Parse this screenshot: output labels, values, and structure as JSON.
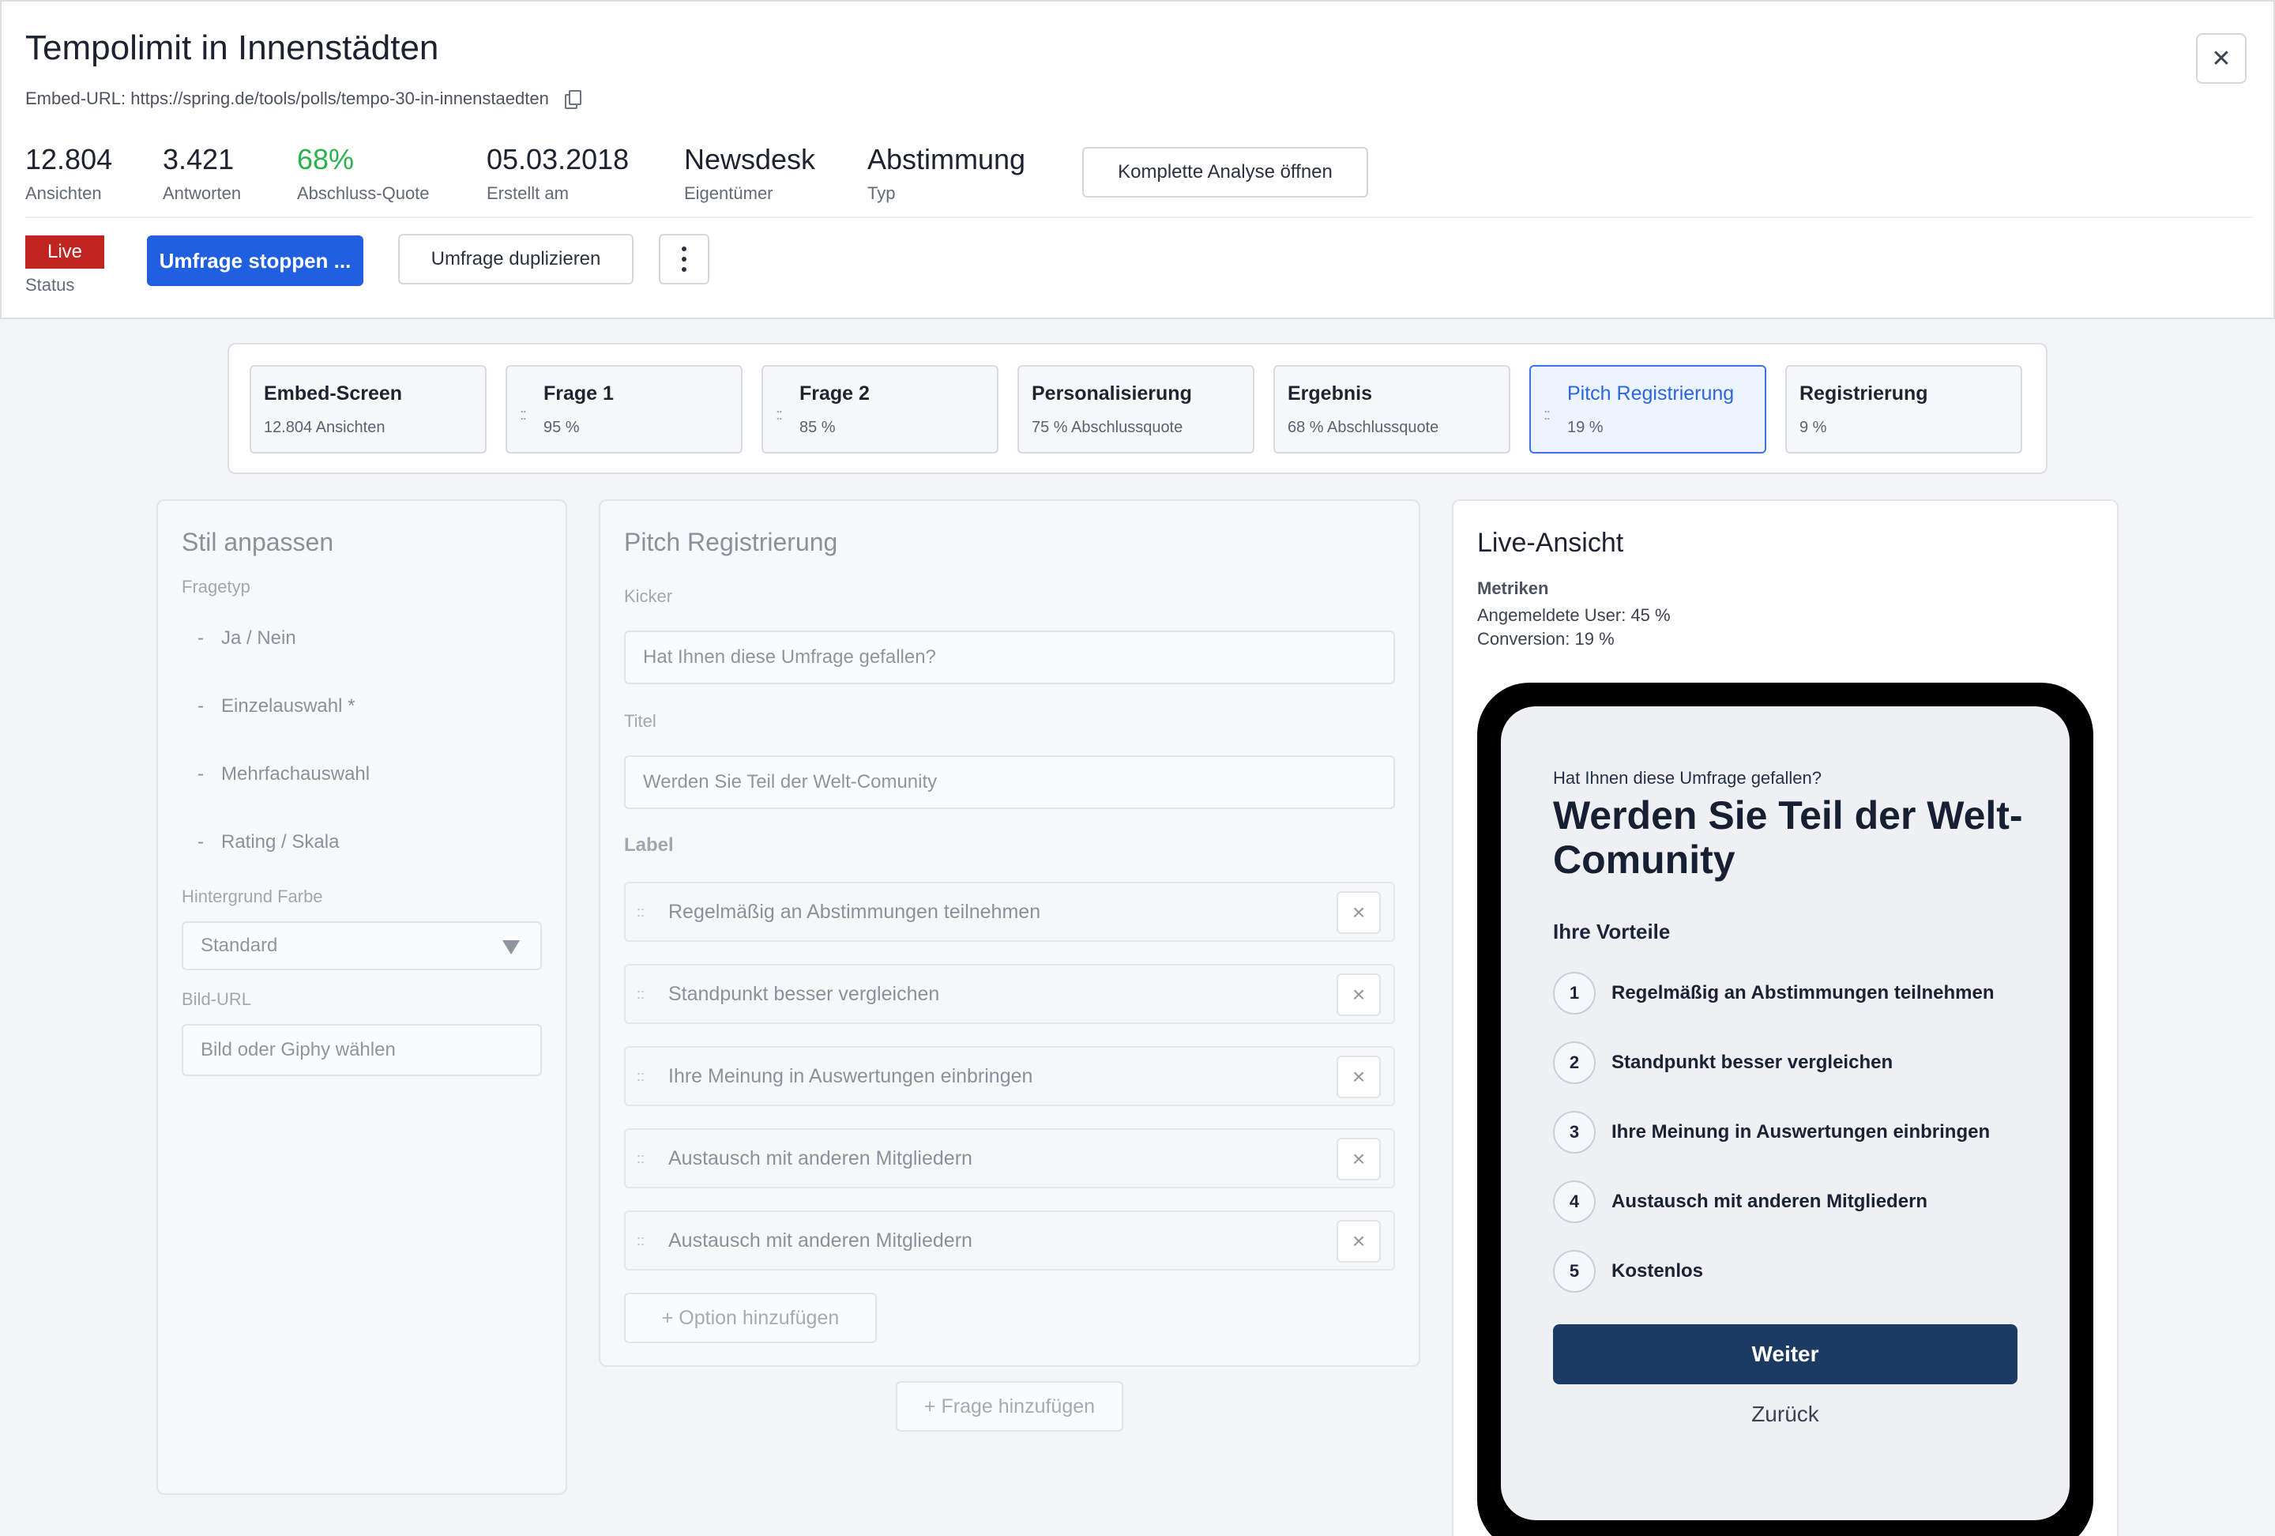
{
  "header": {
    "title": "Tempolimit in Innenstädten",
    "embed_url_label": "Embed-URL: https://spring.de/tools/polls/tempo-30-in-innenstaedten",
    "stats": [
      {
        "value": "12.804",
        "label": "Ansichten"
      },
      {
        "value": "3.421",
        "label": "Antworten"
      },
      {
        "value": "68%",
        "label": "Abschluss-Quote"
      },
      {
        "value": "05.03.2018",
        "label": "Erstellt am"
      },
      {
        "value": "Newsdesk",
        "label": "Eigentümer"
      },
      {
        "value": "Abstimmung",
        "label": "Typ"
      }
    ],
    "analysis_button": "Komplette Analyse öffnen",
    "status_badge": "Live",
    "status_label": "Status",
    "stop_button": "Umfrage stoppen ...",
    "duplicate_button": "Umfrage duplizieren",
    "close_symbol": "✕",
    "accent_color": "#1f5fe0",
    "live_color": "#c0251f",
    "quote_color": "#2bb24c"
  },
  "steps": [
    {
      "title": "Embed-Screen",
      "sub": "12.804 Ansichten"
    },
    {
      "title": "Frage 1",
      "sub": "95 %"
    },
    {
      "title": "Frage 2",
      "sub": "85 %"
    },
    {
      "title": "Personalisierung",
      "sub": "75 % Abschlussquote"
    },
    {
      "title": "Ergebnis",
      "sub": "68 % Abschlussquote"
    },
    {
      "title": "Pitch Registrierung",
      "sub": "19 %"
    },
    {
      "title": "Registrierung",
      "sub": "9 %"
    }
  ],
  "style_panel": {
    "title": "Stil anpassen",
    "fragetyp_label": "Fragetyp",
    "fragetypen": [
      "Ja / Nein",
      "Einzelauswahl *",
      "Mehrfachauswahl",
      "Rating / Skala"
    ],
    "bg_label": "Hintergrund Farbe",
    "bg_value": "Standard",
    "bild_label": "Bild-URL",
    "bild_placeholder": "Bild oder Giphy wählen"
  },
  "editor": {
    "title": "Pitch Registrierung",
    "kicker_label": "Kicker",
    "kicker_value": "Hat Ihnen diese Umfrage gefallen?",
    "titel_label": "Titel",
    "titel_value": "Werden Sie Teil der Welt-Comunity",
    "label_label": "Label",
    "options": [
      "Regelmäßig an Abstimmungen teilnehmen",
      "Standpunkt besser vergleichen",
      "Ihre Meinung in Auswertungen einbringen",
      "Austausch mit anderen Mitgliedern",
      "Austausch mit anderen Mitgliedern"
    ],
    "add_option": "+ Option hinzufügen",
    "add_question": "+ Frage hinzufügen"
  },
  "live_view": {
    "title": "Live-Ansicht",
    "metrics_heading": "Metriken",
    "metric_users": "Angemeldete User: 45 %",
    "metric_conversion": "Conversion: 19 %",
    "kicker": "Hat Ihnen diese Umfrage gefallen?",
    "headline": "Werden Sie Teil der Welt-Comunity",
    "benefits_heading": "Ihre Vorteile",
    "benefits": [
      {
        "num": "1",
        "text": "Regelmäßig an Abstimmungen teilnehmen"
      },
      {
        "num": "2",
        "text": "Standpunkt besser vergleichen"
      },
      {
        "num": "3",
        "text": "Ihre Meinung in Auswertungen einbringen"
      },
      {
        "num": "4",
        "text": "Austausch mit anderen Mitgliedern"
      },
      {
        "num": "5",
        "text": "Kostenlos"
      }
    ],
    "next_button": "Weiter",
    "back_button": "Zurück",
    "button_color": "#1b3a64"
  }
}
